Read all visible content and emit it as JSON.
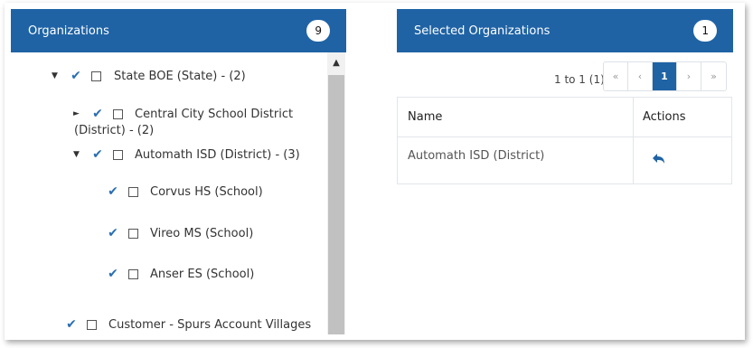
{
  "organizations": {
    "title": "Organizations",
    "count": "9",
    "tree": [
      {
        "caret": "▼",
        "label": "State BOE (State) - (2)"
      },
      {
        "caret": "►",
        "label": "Central City School District",
        "label2": "(District) - (2)"
      },
      {
        "caret": "▼",
        "label": "Automath ISD (District) - (3)"
      },
      {
        "caret": "",
        "label": "Corvus HS (School)"
      },
      {
        "caret": "",
        "label": "Vireo MS (School)"
      },
      {
        "caret": "",
        "label": "Anser ES (School)"
      },
      {
        "caret": "",
        "label": "Customer - Spurs Account Villages"
      }
    ]
  },
  "selected": {
    "title": "Selected Organizations",
    "count": "1",
    "pager_info": "1 to 1 (1)",
    "pager": {
      "first": "«",
      "prev": "‹",
      "current": "1",
      "next": "›",
      "last": "»"
    },
    "columns": {
      "name": "Name",
      "actions": "Actions"
    },
    "rows": [
      {
        "name": "Automath ISD (District)",
        "action_icon": "undo-icon"
      }
    ]
  },
  "colors": {
    "header": "#1f63a5",
    "check": "#2a6eb2"
  }
}
